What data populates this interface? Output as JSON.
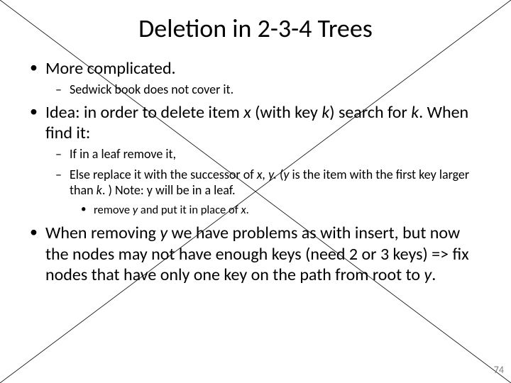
{
  "title": "Deletion in 2-3-4 Trees",
  "bullets": {
    "b1": "More complicated.",
    "b1_1": "Sedwick book does not cover it.",
    "b2_pre": "Idea: in order to delete item ",
    "b2_x": "x",
    "b2_mid": " (with key ",
    "b2_k": "k",
    "b2_post1": ") search for ",
    "b2_k2": "k",
    "b2_post2": ". When find it:",
    "b2_1": "If in a leaf remove it,",
    "b2_2_pre": "Else replace it with the successor of ",
    "b2_2_x": "x, y.",
    "b2_2_mid": " (",
    "b2_2_y": "y",
    "b2_2_post1": " is the item with the first key larger than ",
    "b2_2_k": "k",
    "b2_2_post2": ". ) Note: y will be in a leaf.",
    "b2_2_1_pre": "remove ",
    "b2_2_1_y": "y",
    "b2_2_1_mid": " and put it in place of ",
    "b2_2_1_x": "x",
    "b2_2_1_post": ".",
    "b3_pre": "When removing ",
    "b3_y": "y",
    "b3_mid": " we have problems as with insert, but now the nodes may not have enough keys (need 2 or 3 keys) => fix nodes that have only one key on the path from root to ",
    "b3_y2": "y",
    "b3_post": "."
  },
  "page_number": "74"
}
